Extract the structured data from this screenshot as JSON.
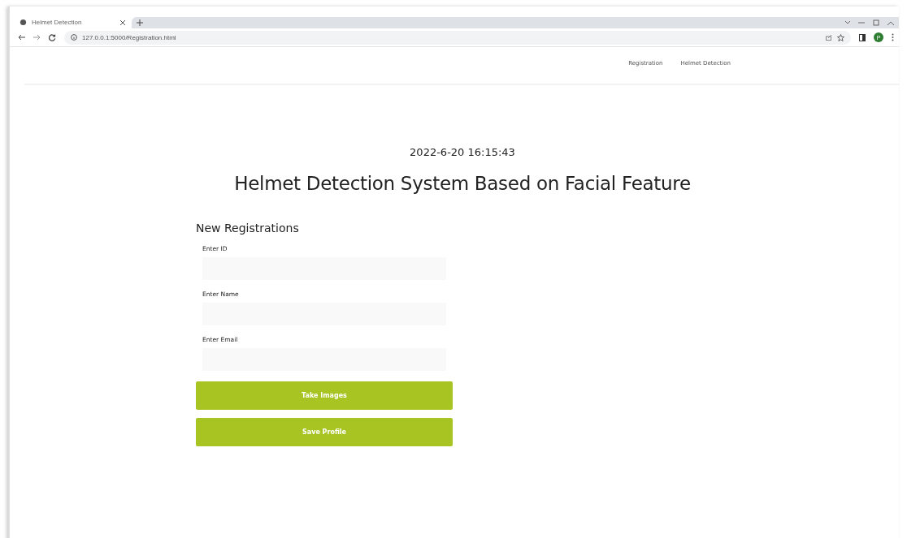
{
  "browser": {
    "tab_title": "Helmet Detection",
    "url": "127.0.0.1:5000/Registration.html",
    "profile_initial": "P"
  },
  "nav": {
    "links": [
      "Registration",
      "Helmet Detection"
    ]
  },
  "page": {
    "datetime": "2022-6-20 16:15:43",
    "title": "Helmet Detection System Based on Facial Feature",
    "form_title": "New Registrations",
    "fields": [
      {
        "label": "Enter ID"
      },
      {
        "label": "Enter Name"
      },
      {
        "label": "Enter Email"
      }
    ],
    "buttons": [
      "Take Images",
      "Save Profile"
    ]
  }
}
